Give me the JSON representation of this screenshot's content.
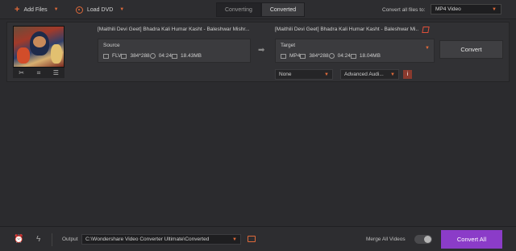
{
  "toolbar": {
    "add_files": "Add Files",
    "load_dvd": "Load DVD",
    "tabs": [
      {
        "label": "Converting",
        "active": false
      },
      {
        "label": "Converted",
        "active": true
      }
    ],
    "convert_all_to_label": "Convert all files to:",
    "convert_all_to_value": "MP4 Video"
  },
  "file": {
    "source_title": "[Maithili Devi Geet] Bhadra Kali Humar Kasht - Baleshwar Mishr...",
    "target_title": "[Maithili Devi Geet] Bhadra Kali Humar Kasht - Baleshwar Mi...",
    "source": {
      "label": "Source",
      "format": "FLV",
      "resolution": "384*288",
      "duration": "04:24",
      "size": "18.43MB"
    },
    "target": {
      "label": "Target",
      "format": "MP4",
      "resolution": "384*288",
      "duration": "04:24",
      "size": "18.04MB"
    },
    "subtitle_select": "None",
    "audio_select": "Advanced Audi...",
    "convert_button": "Convert"
  },
  "bottom": {
    "output_label": "Output",
    "output_path": "C:\\Wondershare Video Converter Ultimate\\Converted",
    "merge_label": "Merge All Videos",
    "merge_enabled": false,
    "convert_all_button": "Convert All"
  },
  "colors": {
    "accent": "#e06a3a",
    "primary_button": "#8b3cc8",
    "background": "#2b2b2e"
  }
}
